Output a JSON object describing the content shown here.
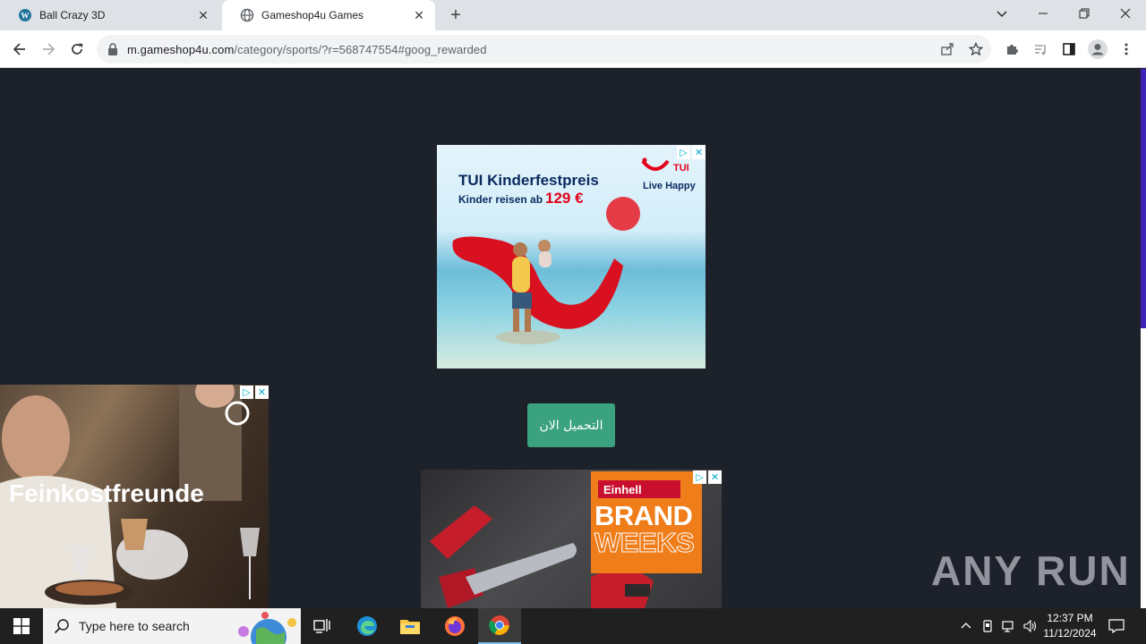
{
  "browser": {
    "tabs": [
      {
        "title": "Ball Crazy 3D",
        "active": false
      },
      {
        "title": "Gameshop4u Games",
        "active": true
      }
    ],
    "url": {
      "domain": "m.gameshop4u.com",
      "path": "/category/sports/?r=568747554#goog_rewarded"
    }
  },
  "page": {
    "ad_tui": {
      "title": "TUI Kinderfestpreis",
      "subtitle": "Kinder reisen ab",
      "price": "129 €",
      "brand": "TUI",
      "slogan": "Live Happy"
    },
    "download_button": "التحميل الان",
    "ad_food": {
      "title": "Feinkostfreunde"
    },
    "ad_einhell": {
      "logo": "Einhell",
      "line1": "BRAND",
      "line2": "WEEKS"
    },
    "watermark": "ANY RUN"
  },
  "taskbar": {
    "search_placeholder": "Type here to search",
    "time": "12:37 PM",
    "date": "11/12/2024"
  },
  "colors": {
    "page_bg": "#1d212a",
    "button_green": "#3aa27e",
    "accent": "#3f22b7"
  }
}
